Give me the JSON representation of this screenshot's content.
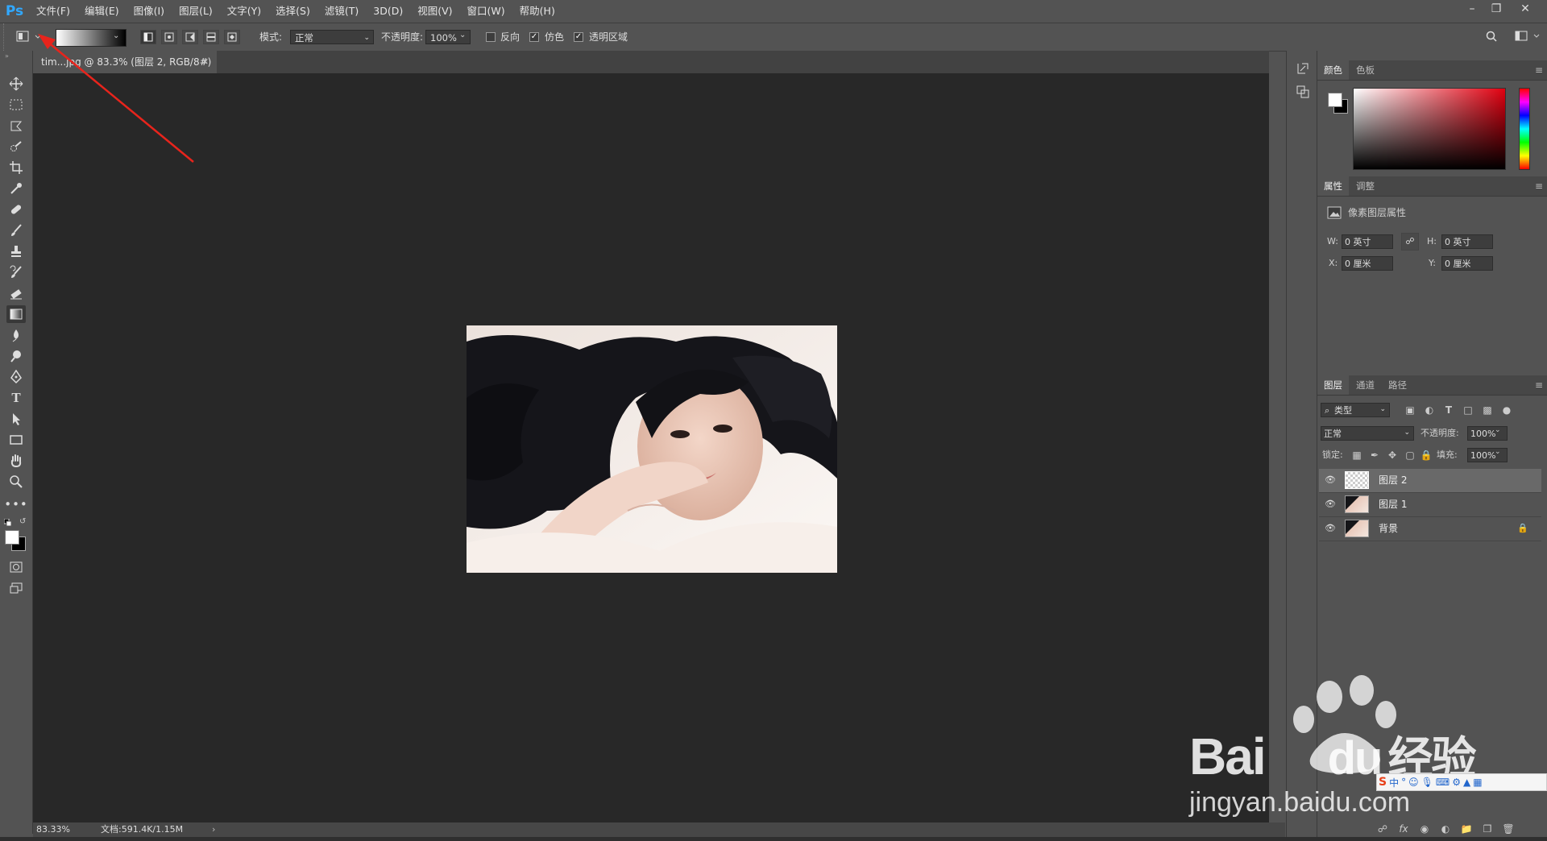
{
  "menubar": {
    "logo": "Ps",
    "items": [
      "文件(F)",
      "编辑(E)",
      "图像(I)",
      "图层(L)",
      "文字(Y)",
      "选择(S)",
      "滤镜(T)",
      "3D(D)",
      "视图(V)",
      "窗口(W)",
      "帮助(H)"
    ],
    "window_controls": [
      "minimize-icon",
      "restore-icon",
      "close-icon"
    ]
  },
  "options": {
    "mode_label": "模式:",
    "mode_value": "正常",
    "opacity_label": "不透明度:",
    "opacity_value": "100%",
    "reverse_label": "反向",
    "reverse_checked": false,
    "dither_label": "仿色",
    "dither_checked": true,
    "transparency_label": "透明区域",
    "transparency_checked": true
  },
  "document": {
    "tab_title": "tim...jpg @ 83.3% (图层 2, RGB/8#) *",
    "zoom": "83.33%",
    "doc_info": "文档:591.4K/1.15M"
  },
  "panels": {
    "color": {
      "tabs": [
        "颜色",
        "色板"
      ]
    },
    "properties": {
      "tabs": [
        "属性",
        "调整"
      ],
      "title": "像素图层属性",
      "w_label": "W:",
      "w_value": "0 英寸",
      "h_label": "H:",
      "h_value": "0 英寸",
      "x_label": "X:",
      "x_value": "0 厘米",
      "y_label": "Y:",
      "y_value": "0 厘米"
    },
    "layers": {
      "tabs": [
        "图层",
        "通道",
        "路径"
      ],
      "filter_value": "类型",
      "blend_value": "正常",
      "opacity_label": "不透明度:",
      "opacity_value": "100%",
      "lock_label": "锁定:",
      "fill_label": "填充:",
      "fill_value": "100%",
      "rows": [
        {
          "name": "图层 2",
          "selected": true,
          "locked": false
        },
        {
          "name": "图层 1",
          "selected": false,
          "locked": false
        },
        {
          "name": "背景",
          "selected": false,
          "locked": true
        }
      ]
    }
  },
  "watermark": {
    "brand": "Bai",
    "brand2": "du",
    "brand_cn": "经验",
    "url": "jingyan.baidu.com"
  },
  "colors": {
    "bg": "#535353",
    "canvas": "#282828",
    "accent": "#31a8ff",
    "arrow": "#e8241c"
  }
}
